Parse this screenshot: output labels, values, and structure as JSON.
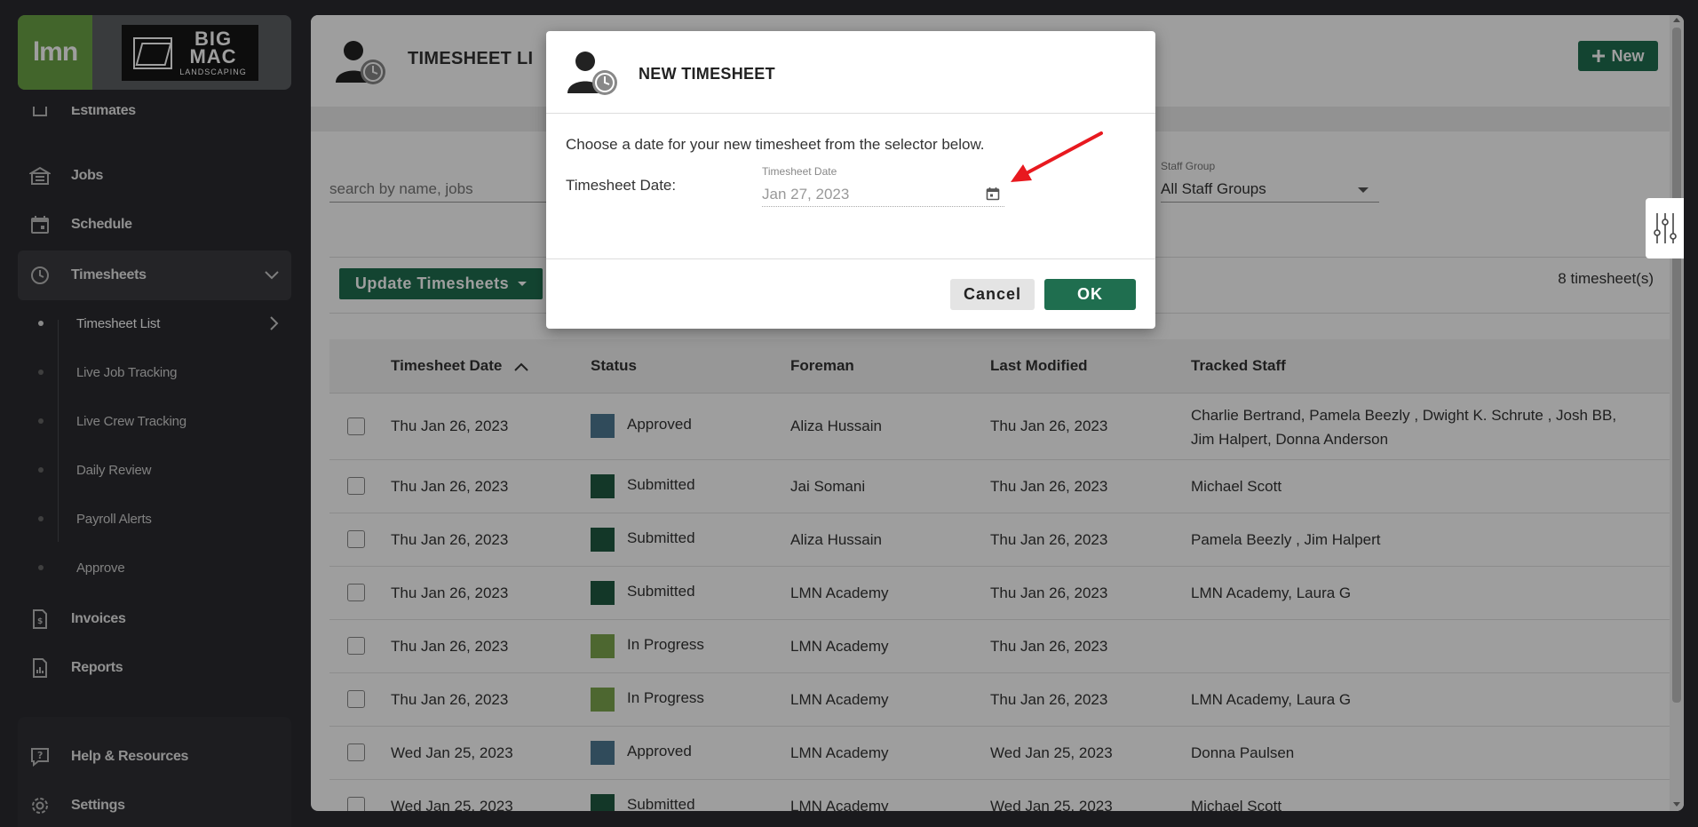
{
  "sidebar": {
    "logo_text": "lmn",
    "partner_logo": {
      "line1": "BIG",
      "line2": "MAC",
      "line3": "LANDSCAPING"
    },
    "items": [
      {
        "label": "Estimates",
        "icon": "estimate-icon"
      },
      {
        "label": "Jobs",
        "icon": "jobs-icon"
      },
      {
        "label": "Schedule",
        "icon": "calendar-icon"
      },
      {
        "label": "Timesheets",
        "icon": "clock-icon"
      }
    ],
    "sub_items": [
      {
        "label": "Timesheet List"
      },
      {
        "label": "Live Job Tracking"
      },
      {
        "label": "Live Crew Tracking"
      },
      {
        "label": "Daily Review"
      },
      {
        "label": "Payroll Alerts"
      },
      {
        "label": "Approve"
      }
    ],
    "lower_items": [
      {
        "label": "Invoices",
        "icon": "invoice-icon"
      },
      {
        "label": "Reports",
        "icon": "reports-icon"
      }
    ],
    "bottom_items": [
      {
        "label": "Help & Resources",
        "icon": "help-icon"
      },
      {
        "label": "Settings",
        "icon": "gear-icon"
      }
    ]
  },
  "header": {
    "title": "TIMESHEET LI",
    "new_button": "New"
  },
  "filters": {
    "search_placeholder": "search by name, jobs",
    "staff_group_label": "Staff Group",
    "staff_group_value": "All Staff Groups"
  },
  "toolbar": {
    "update_button": "Update Timesheets",
    "count_text": "8  timesheet(s)"
  },
  "table": {
    "columns": [
      "Timesheet Date",
      "Status",
      "Foreman",
      "Last Modified",
      "Tracked Staff"
    ],
    "rows": [
      {
        "date": "Thu Jan 26, 2023",
        "status": "Approved",
        "status_color": "#4e7a93",
        "foreman": "Aliza Hussain",
        "modified": "Thu Jan 26, 2023",
        "staff": "Charlie Bertrand, Pamela Beezly , Dwight K. Schrute , Josh BB,",
        "staff2": "Jim Halpert, Donna Anderson"
      },
      {
        "date": "Thu Jan 26, 2023",
        "status": "Submitted",
        "status_color": "#1f5a42",
        "foreman": "Jai Somani",
        "modified": "Thu Jan 26, 2023",
        "staff": "Michael Scott",
        "staff2": ""
      },
      {
        "date": "Thu Jan 26, 2023",
        "status": "Submitted",
        "status_color": "#1f5a42",
        "foreman": "Aliza Hussain",
        "modified": "Thu Jan 26, 2023",
        "staff": "Pamela Beezly , Jim Halpert",
        "staff2": ""
      },
      {
        "date": "Thu Jan 26, 2023",
        "status": "Submitted",
        "status_color": "#1f5a42",
        "foreman": "LMN Academy",
        "modified": "Thu Jan 26, 2023",
        "staff": "LMN Academy, Laura G",
        "staff2": ""
      },
      {
        "date": "Thu Jan 26, 2023",
        "status": "In Progress",
        "status_color": "#7da64e",
        "foreman": "LMN Academy",
        "modified": "Thu Jan 26, 2023",
        "staff": "",
        "staff2": ""
      },
      {
        "date": "Thu Jan 26, 2023",
        "status": "In Progress",
        "status_color": "#7da64e",
        "foreman": "LMN Academy",
        "modified": "Thu Jan 26, 2023",
        "staff": "LMN Academy, Laura G",
        "staff2": ""
      },
      {
        "date": "Wed Jan 25, 2023",
        "status": "Approved",
        "status_color": "#4e7a93",
        "foreman": "LMN Academy",
        "modified": "Wed Jan 25, 2023",
        "staff": "Donna Paulsen",
        "staff2": ""
      },
      {
        "date": "Wed Jan 25, 2023",
        "status": "Submitted",
        "status_color": "#1f5a42",
        "foreman": "LMN Academy",
        "modified": "Wed Jan 25, 2023",
        "staff": "Michael Scott",
        "staff2": ""
      }
    ]
  },
  "modal": {
    "title": "NEW TIMESHEET",
    "description": "Choose a date for your new timesheet from the selector below.",
    "date_label": "Timesheet Date:",
    "date_caption": "Timesheet Date",
    "date_value": "Jan 27, 2023",
    "cancel_button": "Cancel",
    "ok_button": "OK"
  },
  "colors": {
    "brand_green": "#1f6e4f",
    "lmn_green": "#6ba446",
    "annotation_arrow": "#e8191f"
  }
}
